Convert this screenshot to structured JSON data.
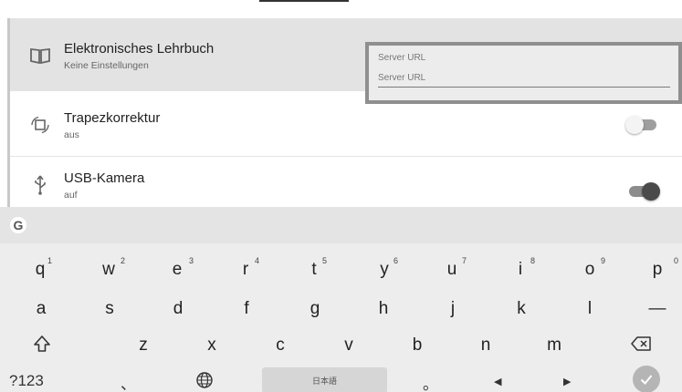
{
  "settings": {
    "items": [
      {
        "title": "Elektronisches Lehrbuch",
        "subtitle": "Keine Einstellungen",
        "icon": "book-icon"
      },
      {
        "title": "Trapezkorrektur",
        "subtitle": "aus",
        "icon": "keystone-icon",
        "toggle": "off"
      },
      {
        "title": "USB-Kamera",
        "subtitle": "auf",
        "icon": "usb-icon",
        "toggle": "on"
      }
    ],
    "server_url": {
      "label": "Server URL",
      "placeholder": "Server URL"
    }
  },
  "keyboard": {
    "row1": [
      {
        "k": "q",
        "n": "1"
      },
      {
        "k": "w",
        "n": "2"
      },
      {
        "k": "e",
        "n": "3"
      },
      {
        "k": "r",
        "n": "4"
      },
      {
        "k": "t",
        "n": "5"
      },
      {
        "k": "y",
        "n": "6"
      },
      {
        "k": "u",
        "n": "7"
      },
      {
        "k": "i",
        "n": "8"
      },
      {
        "k": "o",
        "n": "9"
      },
      {
        "k": "p",
        "n": "0"
      }
    ],
    "row2": [
      "a",
      "s",
      "d",
      "f",
      "g",
      "h",
      "j",
      "k",
      "l",
      "—"
    ],
    "row3": [
      "z",
      "x",
      "c",
      "v",
      "b",
      "n",
      "m"
    ],
    "symbols_label": "?123",
    "comma": "、",
    "space_label": "日本語",
    "period": "。"
  },
  "colors": {
    "selected_row": "#e3e3e3",
    "url_box_border": "#8f8f8f",
    "keyboard_bg": "#ededed"
  }
}
